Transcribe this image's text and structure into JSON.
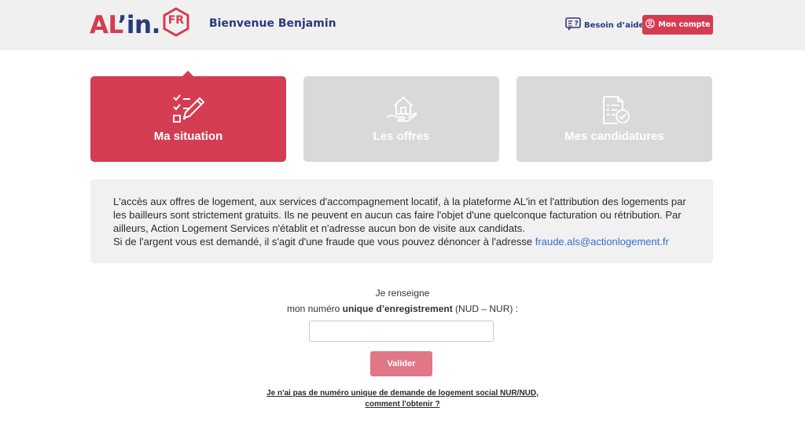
{
  "header": {
    "logo": {
      "part1": "AL",
      "part2": "’in.",
      "badge": "FR"
    },
    "welcome_prefix": "Bienvenue",
    "user_name": "Benjamin",
    "help_label": "Besoin d’aide",
    "account_label": "Mon compte"
  },
  "tabs": [
    {
      "label": "Ma situation",
      "icon": "checklist-pencil-icon",
      "active": true
    },
    {
      "label": "Les offres",
      "icon": "hand-house-icon",
      "active": false
    },
    {
      "label": "Mes candidatures",
      "icon": "document-check-icon",
      "active": false
    }
  ],
  "notice": {
    "text": "L'accès aux offres de logement, aux services d'accompagnement locatif, à la plateforme AL'in et l'attribution des logements par les bailleurs sont strictement gratuits. Ils ne peuvent en aucun cas faire l'objet d'une quelconque facturation ou rétribution. Par ailleurs, Action Logement Services n'établit et n'adresse aucun bon de visite aux candidats.",
    "fraud_text": "Si de l'argent vous est demandé, il s'agit d'une fraude que vous pouvez dénoncer à l'adresse",
    "email": "fraude.als@actionlogement.fr"
  },
  "nud": {
    "line1": "Je renseigne",
    "line2_prefix": "mon numéro",
    "line2_bold": "unique d’enregistrement",
    "line2_suffix": "(NUD – NUR) :",
    "input_value": "",
    "input_placeholder": "",
    "submit_label": "Valider",
    "help_link_line1": "Je n'ai pas de numéro unique de demande de logement social NUR/NUD,",
    "help_link_line2": "comment l'obtenir ?"
  },
  "colors": {
    "brand_red": "#d43d51",
    "brand_blue": "#2a3a7c",
    "tile_inactive": "#d9d9d9",
    "button_disabled": "#e07686",
    "link": "#2f6fd0"
  }
}
